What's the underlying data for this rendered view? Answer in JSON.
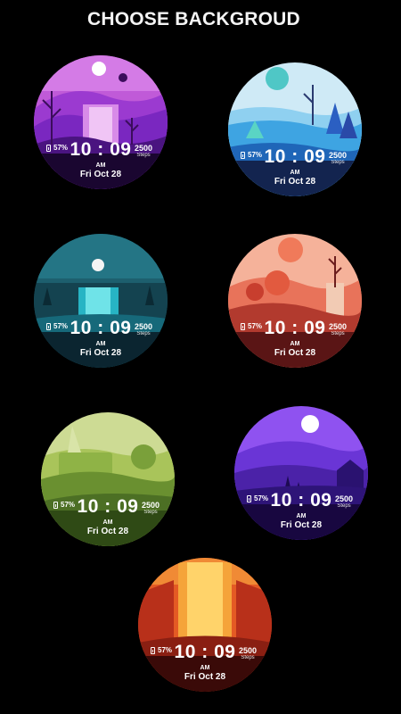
{
  "header": {
    "title": "CHOOSE BACKGROUD"
  },
  "watch": {
    "battery": "57%",
    "time": "10 : 09",
    "ampm": "AM",
    "date": "Fri Oct 28",
    "steps_value": "2500",
    "steps_label": "Steps"
  },
  "backgrounds": [
    {
      "theme": "purple-waterfall",
      "colors": [
        "#b24bd6",
        "#7a2bd0",
        "#2b0a4a"
      ]
    },
    {
      "theme": "blue-forest",
      "colors": [
        "#cbe9f5",
        "#39a9e4",
        "#1e3b84"
      ]
    },
    {
      "theme": "night-waterfall",
      "colors": [
        "#1f6a78",
        "#2fc8d1",
        "#0e2a3a"
      ]
    },
    {
      "theme": "red-desert",
      "colors": [
        "#f6b39a",
        "#e0604a",
        "#6b1d1d"
      ]
    },
    {
      "theme": "green-hills",
      "colors": [
        "#c9d98a",
        "#7ea83a",
        "#3f6320"
      ]
    },
    {
      "theme": "violet-night",
      "colors": [
        "#8c4ef0",
        "#5a28c8",
        "#1d0b52"
      ]
    },
    {
      "theme": "orange-canyon",
      "colors": [
        "#f2a33b",
        "#d8441f",
        "#4a0f0a"
      ]
    }
  ]
}
